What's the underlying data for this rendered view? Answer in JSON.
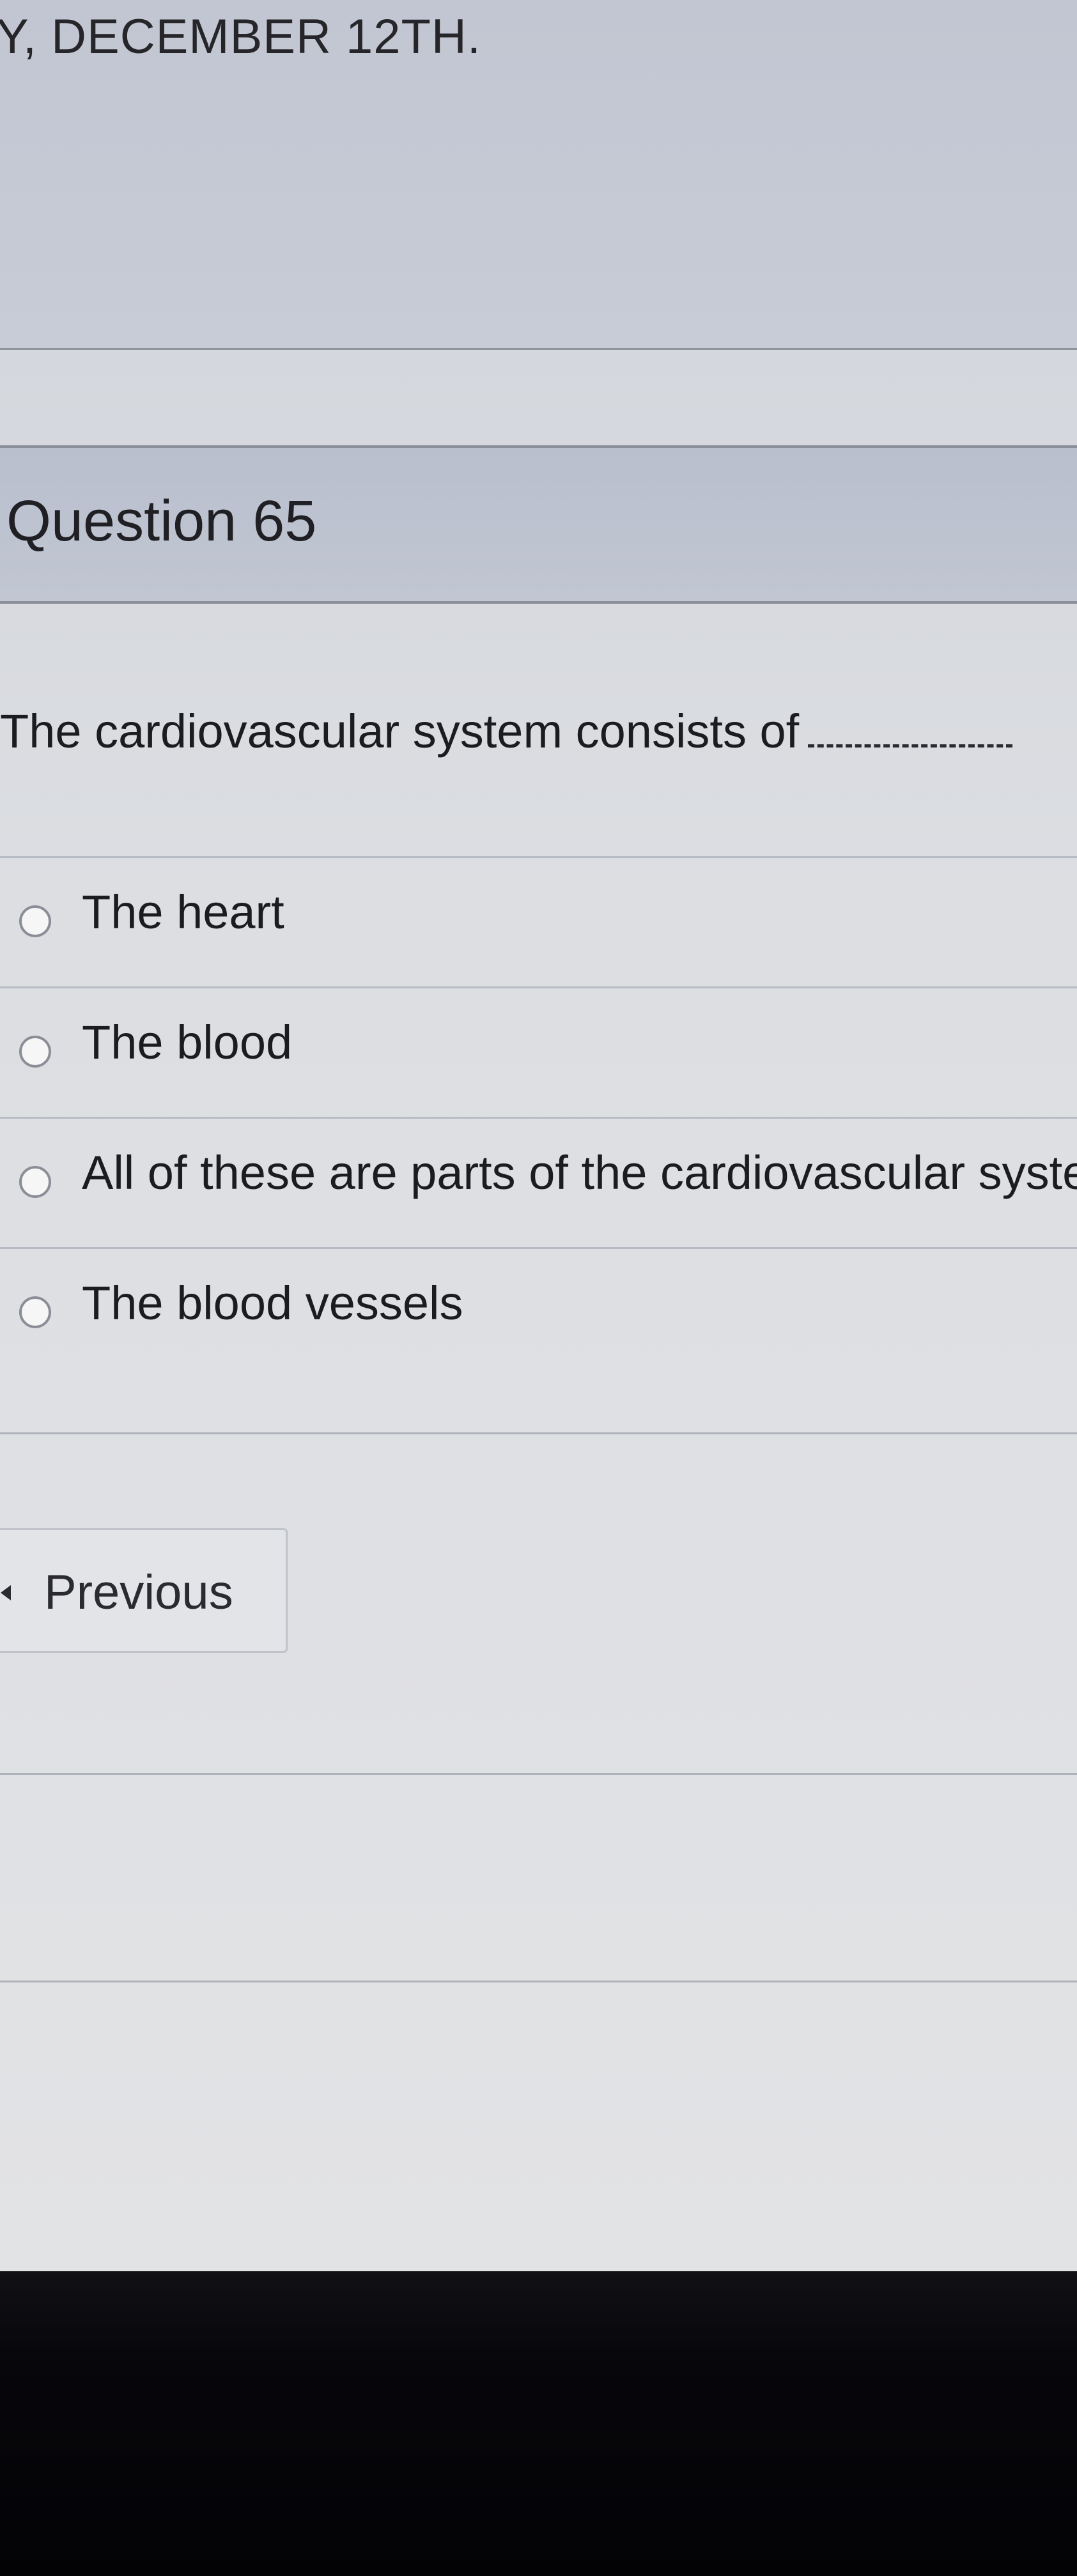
{
  "banner": {
    "title": "Y, DECEMBER 12TH."
  },
  "question": {
    "heading": "Question 65",
    "text": "The cardiovascular system consists of"
  },
  "answers": [
    {
      "label": "The heart",
      "selected": false
    },
    {
      "label": "The blood",
      "selected": false
    },
    {
      "label": "All of these are parts of the cardiovascular systen",
      "selected": false
    },
    {
      "label": "The blood vessels",
      "selected": false
    }
  ],
  "navigation": {
    "previous_label": "Previous"
  }
}
